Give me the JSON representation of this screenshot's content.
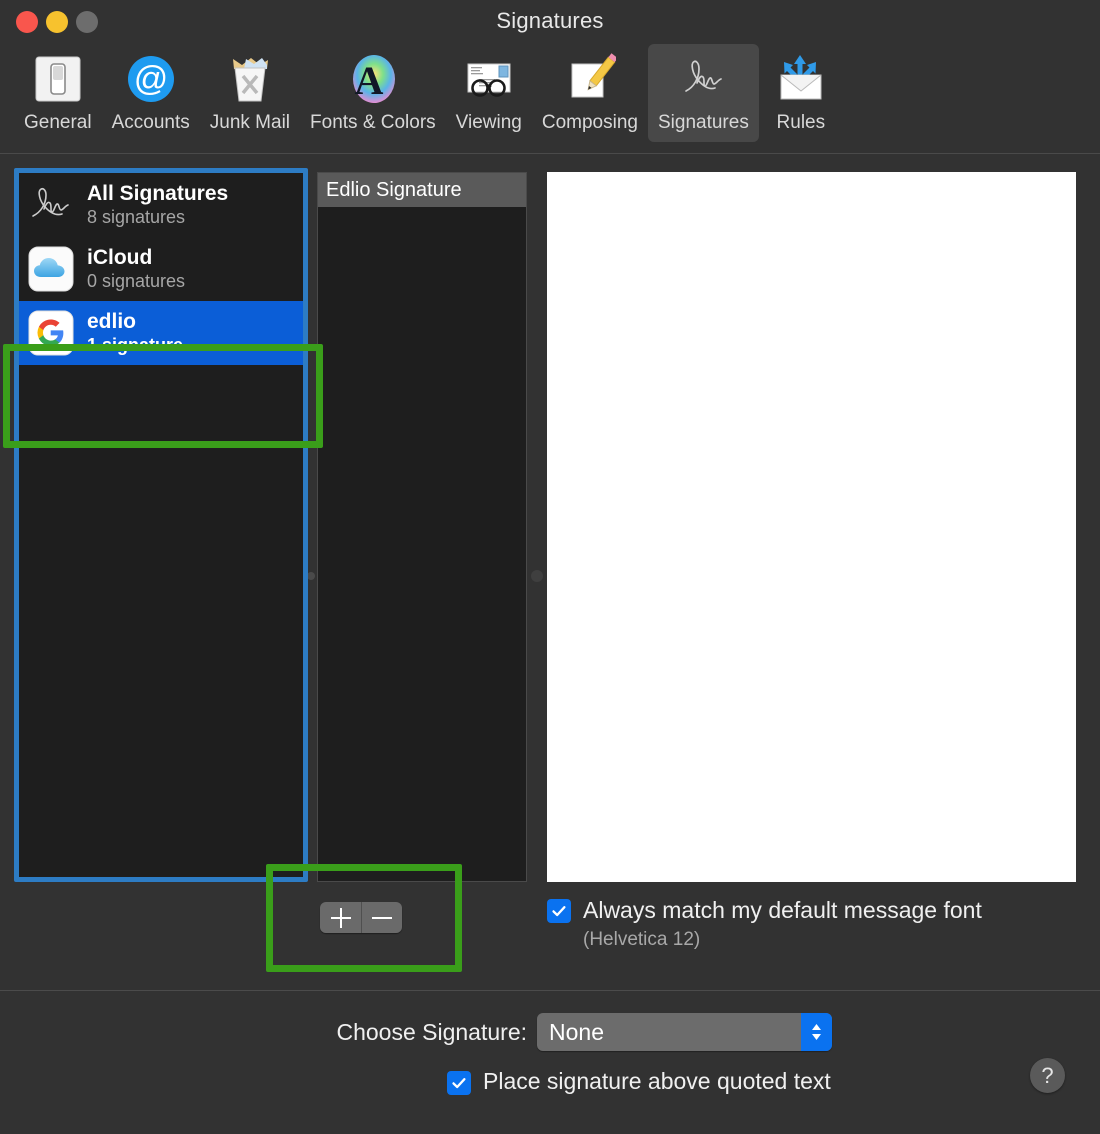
{
  "window": {
    "title": "Signatures",
    "traffic_lights": [
      {
        "name": "close",
        "color": "#f9564d"
      },
      {
        "name": "minimize",
        "color": "#f7c22e"
      },
      {
        "name": "zoom",
        "color": "#6d6d6d"
      }
    ]
  },
  "toolbar": {
    "items": [
      {
        "label": "General",
        "icon": "general-switch-icon",
        "selected": false
      },
      {
        "label": "Accounts",
        "icon": "at-sign-icon",
        "selected": false
      },
      {
        "label": "Junk Mail",
        "icon": "junk-trash-icon",
        "selected": false
      },
      {
        "label": "Fonts & Colors",
        "icon": "font-color-wheel-icon",
        "selected": false
      },
      {
        "label": "Viewing",
        "icon": "glasses-envelope-icon",
        "selected": false
      },
      {
        "label": "Composing",
        "icon": "pencil-paper-icon",
        "selected": false
      },
      {
        "label": "Signatures",
        "icon": "signature-icon",
        "selected": true
      },
      {
        "label": "Rules",
        "icon": "rules-arrows-icon",
        "selected": false
      }
    ]
  },
  "accounts_list": {
    "rows": [
      {
        "name": "All Signatures",
        "sub": "8 signatures",
        "icon": "signature-icon",
        "selected": false
      },
      {
        "name": "iCloud",
        "sub": "0 signatures",
        "icon": "icloud-icon",
        "selected": false
      },
      {
        "name": "edlio",
        "sub": "1 signature",
        "icon": "google-g-icon",
        "selected": true
      }
    ]
  },
  "signature_list": {
    "rows": [
      {
        "label": "Edlio Signature",
        "selected": true
      }
    ]
  },
  "add_remove": {
    "add_label": "+",
    "remove_label": "–"
  },
  "preview": {
    "content": ""
  },
  "match_font": {
    "checked": true,
    "label": "Always match my default message font",
    "sub": "(Helvetica 12)"
  },
  "footer": {
    "choose_label": "Choose Signature:",
    "choose_value": "None",
    "choose_options": [
      "None"
    ],
    "quote_checked": true,
    "quote_label": "Place signature above quoted text",
    "help_label": "?"
  },
  "annotations": {
    "accounts_box_color": "#2d7cc4",
    "edlio_box_color": "#3a9e1a",
    "addremove_box_color": "#3a9e1a"
  },
  "colors": {
    "window_bg": "#323232",
    "list_bg": "#1e1e1e",
    "selection_blue": "#0b5ed7",
    "control_blue": "#0a72f0",
    "preview_white": "#ffffff"
  }
}
